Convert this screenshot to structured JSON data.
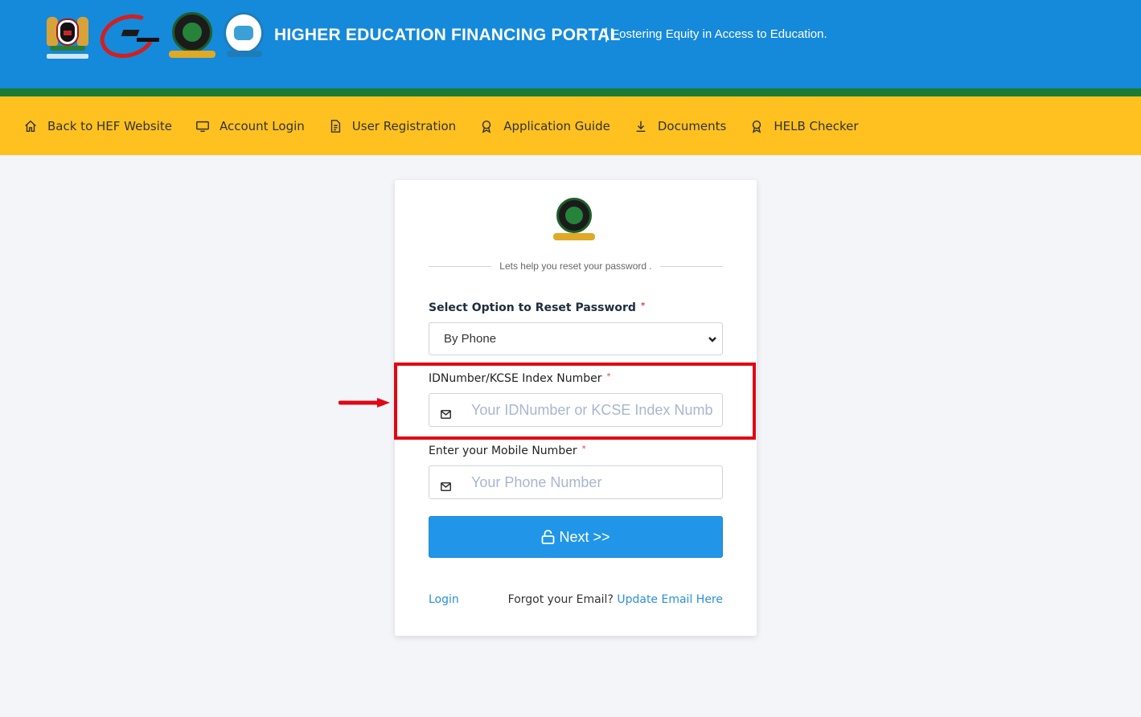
{
  "header": {
    "title": "HIGHER EDUCATION FINANCING PORTAL",
    "separator": "|",
    "tagline": "Fostering Equity in Access to Education."
  },
  "nav": {
    "items": [
      {
        "label": "Back to HEF Website",
        "icon": "home-icon"
      },
      {
        "label": "Account Login",
        "icon": "monitor-icon"
      },
      {
        "label": "User Registration",
        "icon": "document-icon"
      },
      {
        "label": "Application Guide",
        "icon": "award-icon"
      },
      {
        "label": "Documents",
        "icon": "download-icon"
      },
      {
        "label": "HELB Checker",
        "icon": "award-icon"
      }
    ]
  },
  "form": {
    "subtitle": "Lets help you reset your password .",
    "reset_option_label": "Select Option to Reset Password",
    "reset_option_value": "By Phone",
    "required_mark": "*",
    "id_label": "IDNumber/KCSE Index Number",
    "id_placeholder": "Your IDNumber or KCSE Index Number",
    "phone_label": "Enter your Mobile Number",
    "phone_placeholder": "Your Phone Number",
    "next_button": "Next >>",
    "login_link": "Login",
    "forgot_email_text": "Forgot your Email?",
    "update_email_link": "Update Email Here"
  },
  "colors": {
    "header_blue": "#1589da",
    "nav_yellow": "#fec120",
    "stripe_green": "#1c7a35",
    "button_blue": "#2196e8",
    "highlight_red": "#e10613"
  }
}
